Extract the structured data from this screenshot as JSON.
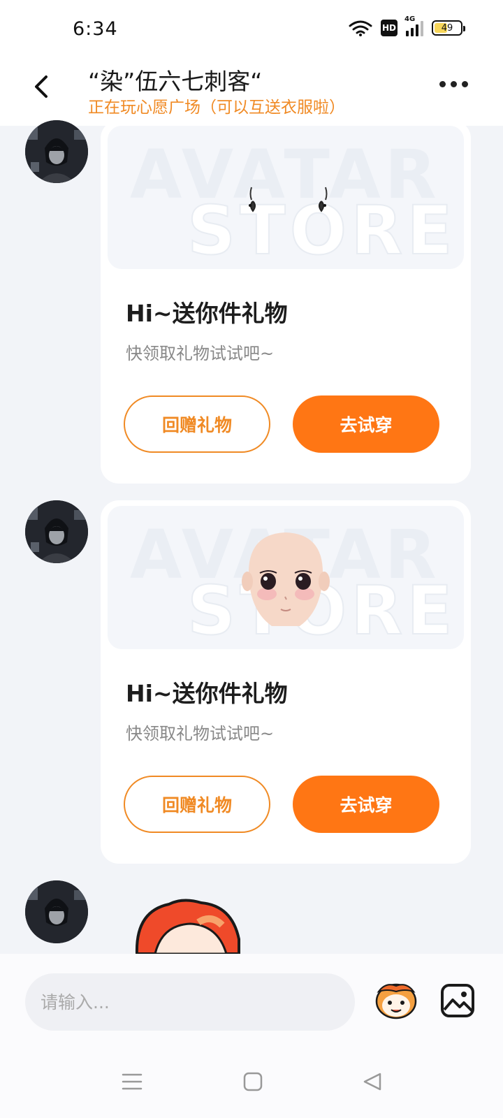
{
  "status_bar": {
    "time": "6:34",
    "hd_label": "HD",
    "network_label": "4G",
    "battery_level": "49"
  },
  "header": {
    "title": "“染”伍六七刺客“",
    "subtitle": "正在玩心愿广场（可以互送衣服啦）"
  },
  "messages": [
    {
      "watermark_top": "AVATAR",
      "watermark_bottom": "STORE",
      "title": "Hi~送你件礼物",
      "desc": "快领取礼物试试吧~",
      "return_gift_label": "回赠礼物",
      "try_on_label": "去试穿"
    },
    {
      "watermark_top": "AVATAR",
      "watermark_bottom": "STORE",
      "title": "Hi~送你件礼物",
      "desc": "快领取礼物试试吧~",
      "return_gift_label": "回赠礼物",
      "try_on_label": "去试穿"
    }
  ],
  "composer": {
    "placeholder": "请输入..."
  },
  "colors": {
    "accent": "#ff7614",
    "accent_text": "#f08a24",
    "background": "#f2f4f8"
  },
  "icons": [
    "back-icon",
    "more-icon",
    "wifi-icon",
    "emoji-mascot-icon",
    "image-icon",
    "nav-menu-icon",
    "nav-home-icon",
    "nav-back-icon"
  ]
}
